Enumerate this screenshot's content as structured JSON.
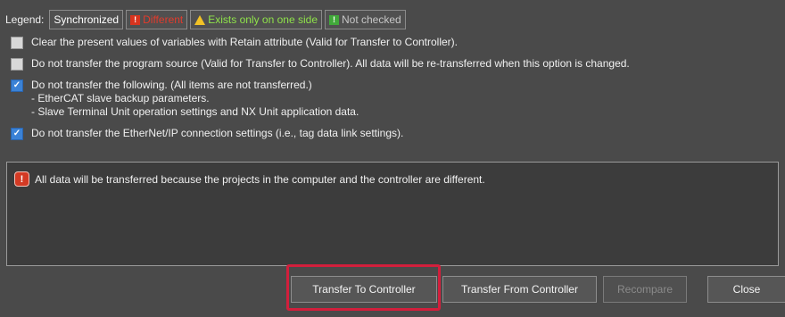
{
  "legend": {
    "label": "Legend:",
    "synchronized": "Synchronized",
    "different": "Different",
    "exists_one_side": "Exists only on one side",
    "not_checked": "Not checked"
  },
  "options": [
    {
      "checked": false,
      "lines": [
        "Clear the present values of variables with Retain attribute (Valid for Transfer to Controller)."
      ]
    },
    {
      "checked": false,
      "lines": [
        "Do not transfer the program source (Valid for Transfer to Controller). All data will be re-transferred when this option is changed."
      ]
    },
    {
      "checked": true,
      "lines": [
        "Do not transfer the following. (All items are not transferred.)",
        "- EtherCAT slave backup parameters.",
        "- Slave Terminal Unit operation settings and NX Unit application data."
      ]
    },
    {
      "checked": true,
      "lines": [
        "Do not transfer the EtherNet/IP connection settings (i.e., tag data link settings)."
      ]
    }
  ],
  "message": "All data will be transferred because the projects in the computer and the controller are different.",
  "buttons": {
    "transfer_to": "Transfer To Controller",
    "transfer_from": "Transfer From Controller",
    "recompare": "Recompare",
    "close": "Close"
  },
  "colors": {
    "highlight": "#d21f3c",
    "checkbox_checked": "#3b82d6",
    "error_icon": "#d33a24"
  }
}
